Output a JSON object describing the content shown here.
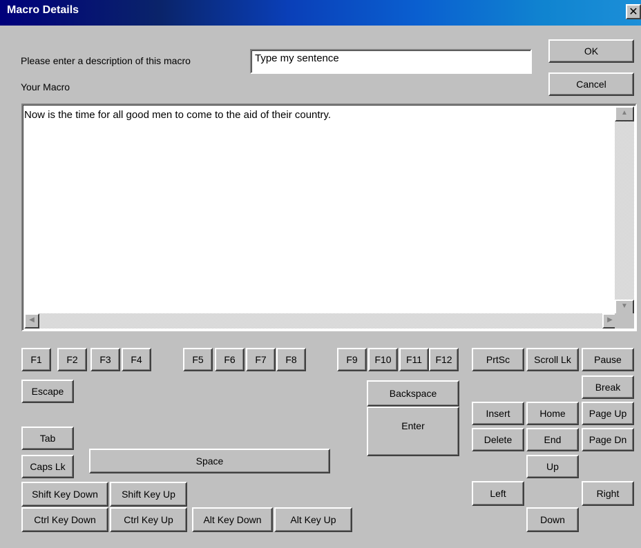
{
  "window": {
    "title": "Macro Details",
    "close_glyph": "✕"
  },
  "description": {
    "label": "Please enter a description of this macro",
    "value": "Type my sentence"
  },
  "macro": {
    "label": "Your Macro",
    "text": "Now is the time for all good men to come to the aid of their country."
  },
  "buttons": {
    "ok": "OK",
    "cancel": "Cancel",
    "f1": "F1",
    "f2": "F2",
    "f3": "F3",
    "f4": "F4",
    "f5": "F5",
    "f6": "F6",
    "f7": "F7",
    "f8": "F8",
    "f9": "F9",
    "f10": "F10",
    "f11": "F11",
    "f12": "F12",
    "prtsc": "PrtSc",
    "scroll_lk": "Scroll Lk",
    "pause": "Pause",
    "break": "Break",
    "escape": "Escape",
    "backspace": "Backspace",
    "enter": "Enter",
    "insert": "Insert",
    "home": "Home",
    "page_up": "Page Up",
    "delete": "Delete",
    "end": "End",
    "page_dn": "Page Dn",
    "tab": "Tab",
    "caps_lk": "Caps Lk",
    "space": "Space",
    "up": "Up",
    "left": "Left",
    "right": "Right",
    "down": "Down",
    "shift_down": "Shift Key Down",
    "shift_up": "Shift Key Up",
    "ctrl_down": "Ctrl Key Down",
    "ctrl_up": "Ctrl Key Up",
    "alt_down": "Alt Key Down",
    "alt_up": "Alt Key Up"
  },
  "scrollbar_glyphs": {
    "up": "▲",
    "down": "▼",
    "left": "◀",
    "right": "▶"
  }
}
